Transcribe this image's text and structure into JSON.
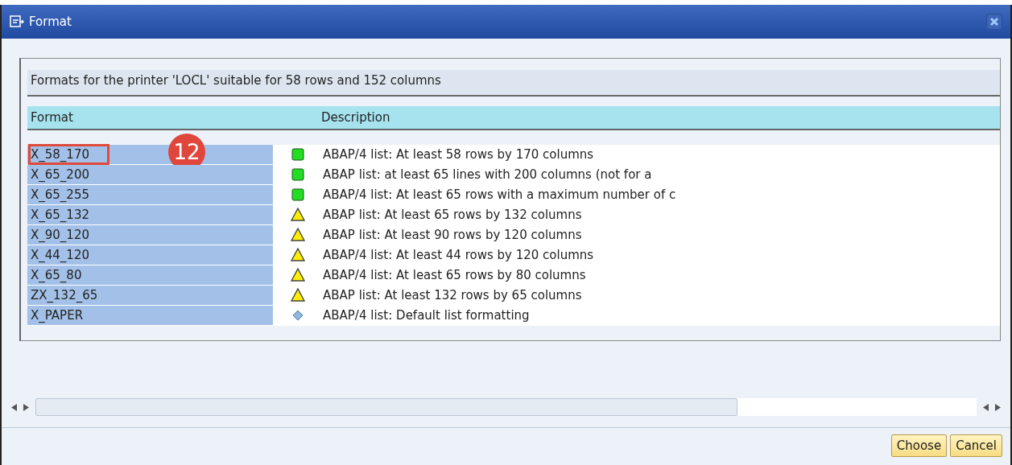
{
  "window": {
    "title": "Format"
  },
  "heading": "Formats for the printer 'LOCL' suitable for 58 rows and 152 columns",
  "columns": [
    "Format",
    "Description"
  ],
  "rows": [
    {
      "format": "X_58_170",
      "kind": "ok",
      "description": "ABAP/4 list: At least 58 rows by 170 columns",
      "outlined": true,
      "callout": "12"
    },
    {
      "format": "X_65_200",
      "kind": "ok",
      "description": "ABAP list: at least 65 lines with 200 columns (not for a",
      "outlined": false
    },
    {
      "format": "X_65_255",
      "kind": "ok",
      "description": "ABAP/4 list: At least 65 rows with a maximum number of c",
      "outlined": false
    },
    {
      "format": "X_65_132",
      "kind": "warning",
      "description": "ABAP list: At least 65 rows by 132 columns",
      "outlined": false
    },
    {
      "format": "X_90_120",
      "kind": "warning",
      "description": "ABAP list: At least 90 rows by 120 columns",
      "outlined": false
    },
    {
      "format": "X_44_120",
      "kind": "warning",
      "description": "ABAP/4 list: At least 44 rows by 120 columns",
      "outlined": false
    },
    {
      "format": "X_65_80",
      "kind": "warning",
      "description": "ABAP/4 list: At least 65 rows by 80 columns",
      "outlined": false
    },
    {
      "format": "ZX_132_65",
      "kind": "warning",
      "description": "ABAP list: At least 132 rows by 65 columns",
      "outlined": false
    },
    {
      "format": "X_PAPER",
      "kind": "default",
      "description": "ABAP/4 list: Default list formatting",
      "outlined": false
    }
  ],
  "buttons": [
    "Choose",
    "Cancel"
  ]
}
